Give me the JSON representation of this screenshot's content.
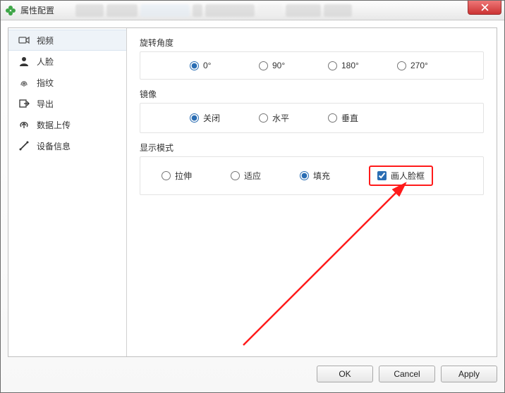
{
  "window": {
    "title": "属性配置"
  },
  "sidebar": {
    "items": [
      {
        "label": "视频",
        "icon": "camera"
      },
      {
        "label": "人脸",
        "icon": "person"
      },
      {
        "label": "指纹",
        "icon": "fingerprint"
      },
      {
        "label": "导出",
        "icon": "export"
      },
      {
        "label": "数据上传",
        "icon": "upload"
      },
      {
        "label": "设备信息",
        "icon": "tools"
      }
    ],
    "selected_index": 0
  },
  "groups": {
    "rotation": {
      "label": "旋转角度",
      "options": [
        "0°",
        "90°",
        "180°",
        "270°"
      ],
      "selected": 0
    },
    "mirror": {
      "label": "镜像",
      "options": [
        "关闭",
        "水平",
        "垂直"
      ],
      "selected": 0
    },
    "display": {
      "label": "显示模式",
      "options": [
        "拉伸",
        "适应",
        "填充"
      ],
      "selected": 2,
      "checkbox": {
        "label": "画人脸框",
        "checked": true
      }
    }
  },
  "buttons": {
    "ok": "OK",
    "cancel": "Cancel",
    "apply": "Apply"
  }
}
